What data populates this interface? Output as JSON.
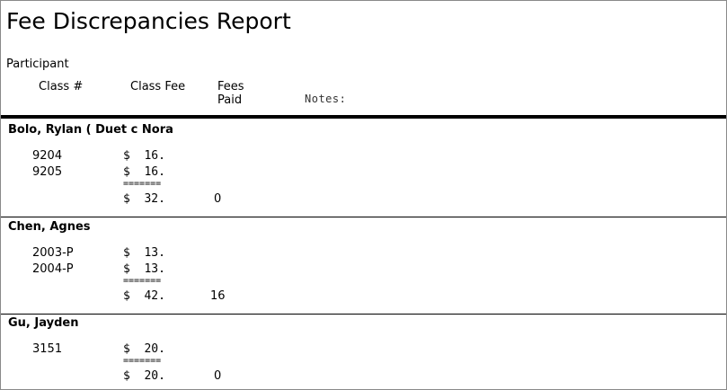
{
  "report": {
    "title": "Fee Discrepancies Report"
  },
  "columns": {
    "participant": "Participant",
    "class_num": "Class #",
    "class_fee": "Class Fee",
    "fees_line1": "Fees",
    "fees_line2": "Paid",
    "notes": "Notes:"
  },
  "separator": "=======",
  "participants": [
    {
      "name": "Bolo, Rylan  ( Duet c Nora",
      "classes": [
        {
          "num": "9204",
          "fee": "$  16."
        },
        {
          "num": "9205",
          "fee": "$  16."
        }
      ],
      "total": "$  32.",
      "paid": "0"
    },
    {
      "name": "Chen, Agnes",
      "classes": [
        {
          "num": "2003-P",
          "fee": "$  13."
        },
        {
          "num": "2004-P",
          "fee": "$  13."
        }
      ],
      "total": "$  42.",
      "paid": "16"
    },
    {
      "name": "Gu, Jayden",
      "classes": [
        {
          "num": "3151",
          "fee": "$  20."
        }
      ],
      "total": "$  20.",
      "paid": "0"
    }
  ]
}
